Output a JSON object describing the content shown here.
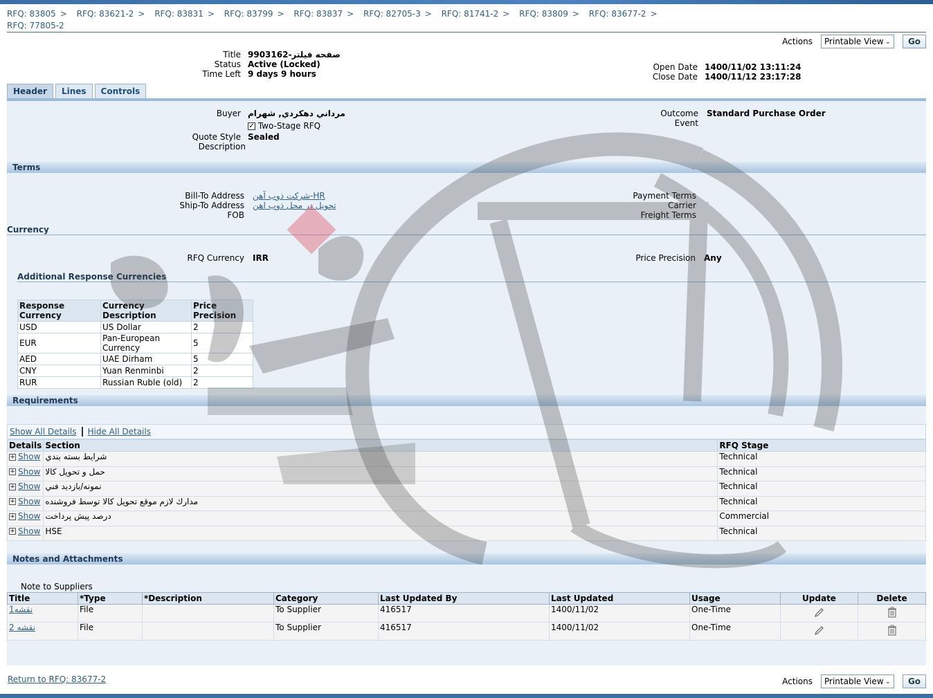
{
  "breadcrumbs": [
    "RFQ: 83805",
    "RFQ: 83621-2",
    "RFQ: 83831",
    "RFQ: 83799",
    "RFQ: 83837",
    "RFQ: 82705-3",
    "RFQ: 81741-2",
    "RFQ: 83809",
    "RFQ: 83677-2"
  ],
  "breadcrumb_sep": ">",
  "page_title": "RFQ: 77805-2",
  "actions": {
    "label": "Actions",
    "selected": "Printable View",
    "go": "Go"
  },
  "summary": {
    "title_label": "Title",
    "title_value": "صفحه فیلتر-9903162",
    "status_label": "Status",
    "status_value": "Active (Locked)",
    "time_left_label": "Time Left",
    "time_left_value": "9 days 9 hours",
    "open_date_label": "Open Date",
    "open_date_value": "1400/11/02 13:11:24",
    "close_date_label": "Close Date",
    "close_date_value": "1400/11/12 23:17:28"
  },
  "tabs": [
    "Header",
    "Lines",
    "Controls"
  ],
  "header": {
    "buyer_label": "Buyer",
    "buyer_value": "مرداني دهكردي, شهرام",
    "two_stage_label": "Two-Stage RFQ",
    "quote_style_label": "Quote Style",
    "quote_style_value": "Sealed",
    "description_label": "Description",
    "outcome_label": "Outcome",
    "outcome_value": "Standard Purchase Order",
    "event_label": "Event"
  },
  "terms": {
    "title": "Terms",
    "bill_to_label": "Bill-To Address",
    "bill_to_value": "شركت ذوب آهن-HR",
    "ship_to_label": "Ship-To Address",
    "ship_to_value": "تحويل در محل ذوب اهن",
    "fob_label": "FOB",
    "payment_terms_label": "Payment Terms",
    "carrier_label": "Carrier",
    "freight_terms_label": "Freight Terms"
  },
  "currency": {
    "title": "Currency",
    "rfq_currency_label": "RFQ Currency",
    "rfq_currency_value": "IRR",
    "price_precision_label": "Price Precision",
    "price_precision_value": "Any",
    "additional_title": "Additional Response Currencies",
    "columns": [
      "Response Currency",
      "Currency Description",
      "Price Precision"
    ],
    "rows": [
      [
        "USD",
        "US Dollar",
        "2"
      ],
      [
        "EUR",
        "Pan-European Currency",
        "5"
      ],
      [
        "AED",
        "UAE Dirham",
        "5"
      ],
      [
        "CNY",
        "Yuan Renminbi",
        "2"
      ],
      [
        "RUR",
        "Russian Ruble (old)",
        "2"
      ]
    ]
  },
  "requirements": {
    "title": "Requirements",
    "show_all": "Show All Details",
    "hide_all": "Hide All Details",
    "columns": [
      "Details",
      "Section",
      "RFQ Stage"
    ],
    "show_label": "Show",
    "rows": [
      {
        "section": "شرايط بسته بندي",
        "stage": "Technical"
      },
      {
        "section": "حمل و تحويل كالا",
        "stage": "Technical"
      },
      {
        "section": "نمونه/بازديد فني",
        "stage": "Technical"
      },
      {
        "section": "مدارك لازم موقع تحويل كالا توسط فروشنده",
        "stage": "Technical"
      },
      {
        "section": "درصد پيش پرداخت",
        "stage": "Commercial"
      },
      {
        "section": "HSE",
        "stage": "Technical"
      }
    ]
  },
  "notes": {
    "title": "Notes and Attachments",
    "note_to_suppliers": "Note to Suppliers",
    "columns": [
      "Title",
      "*Type",
      "*Description",
      "Category",
      "Last Updated By",
      "Last Updated",
      "Usage",
      "Update",
      "Delete"
    ],
    "rows": [
      {
        "title": "نقشه1",
        "type": "File",
        "description": "",
        "category": "To Supplier",
        "updated_by": "416517",
        "updated": "1400/11/02",
        "usage": "One-Time"
      },
      {
        "title": "نقشه 2",
        "type": "File",
        "description": "",
        "category": "To Supplier",
        "updated_by": "416517",
        "updated": "1400/11/02",
        "usage": "One-Time"
      }
    ]
  },
  "return_link": "Return to RFQ: 83677-2",
  "colors": {
    "link": "#2f5f8a",
    "section_header": "#a9c4e0",
    "panel": "#eaf0f7"
  }
}
